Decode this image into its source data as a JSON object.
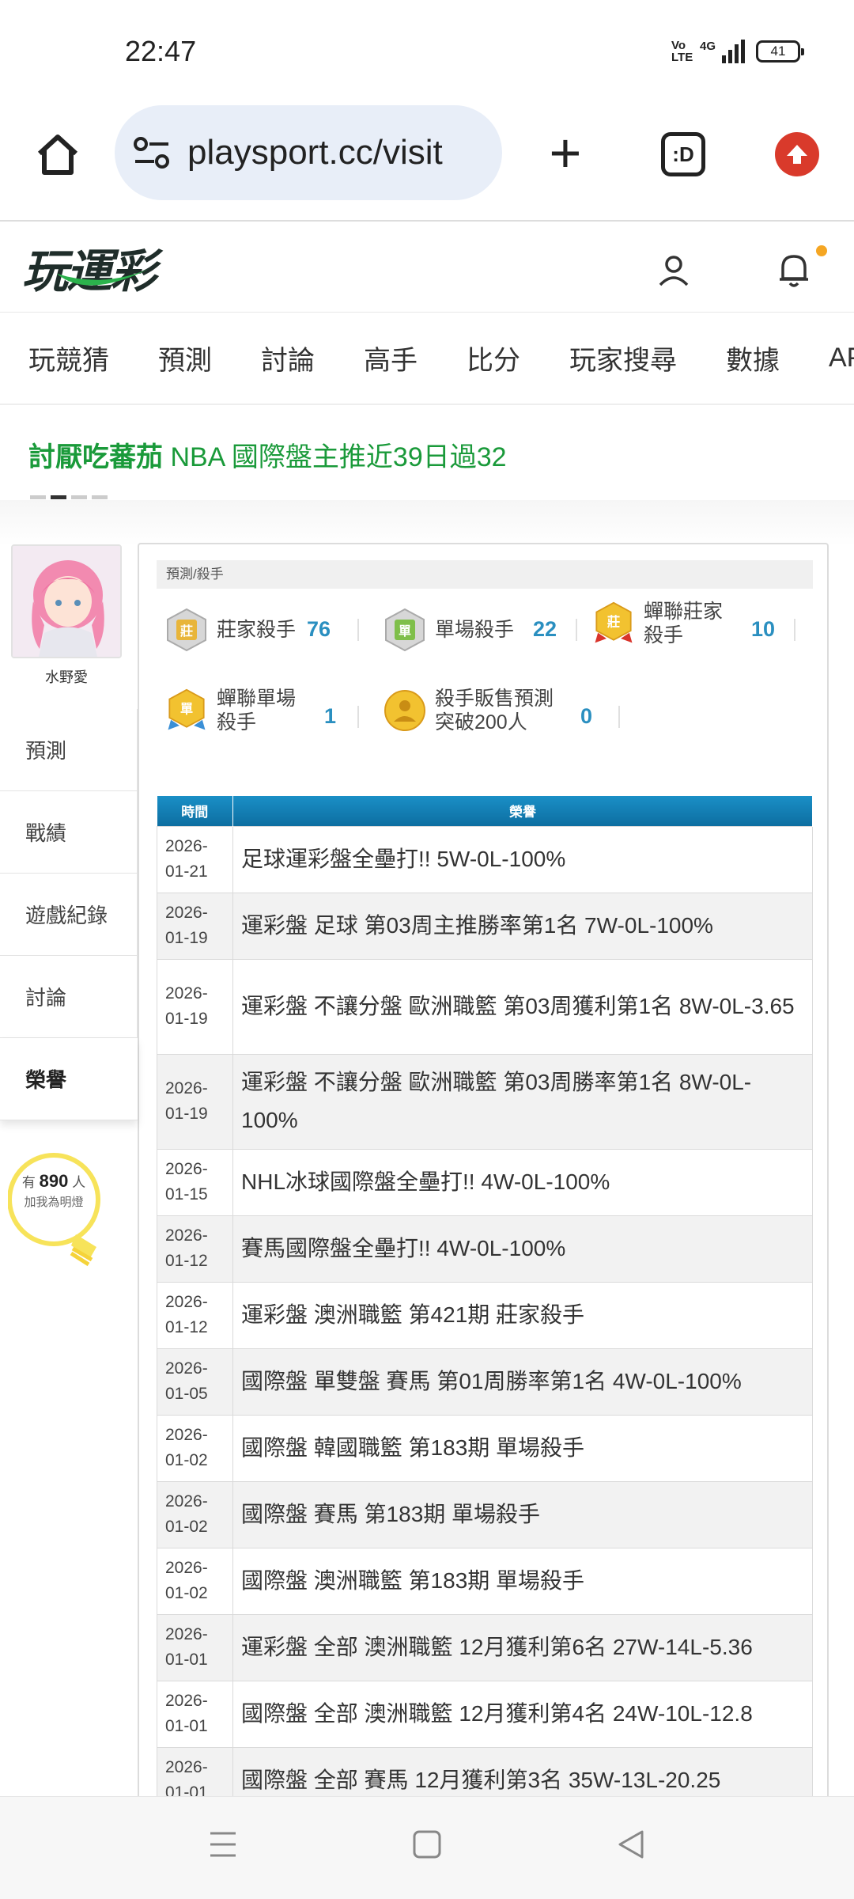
{
  "status": {
    "time": "22:47",
    "network": "4G",
    "volte": "Vo LTE",
    "battery": "41"
  },
  "browser": {
    "url": "playsport.cc/visit",
    "tab_label": ":D"
  },
  "site": {
    "logo": "玩運彩"
  },
  "nav": [
    "玩競猜",
    "預測",
    "討論",
    "高手",
    "比分",
    "玩家搜尋",
    "數據",
    "APP"
  ],
  "ticker": {
    "name": "討厭吃蕃茄",
    "text": "NBA 國際盤主推近39日過32"
  },
  "profile": {
    "username": "水野愛",
    "menu": [
      "預測",
      "戰績",
      "遊戲紀錄",
      "討論",
      "榮譽"
    ],
    "fans_prefix": "有",
    "fans_count": "890",
    "fans_suffix": "人",
    "fans_label": "加我為明燈"
  },
  "breadcrumb": "預測/殺手",
  "medals": [
    {
      "icon": "banker-killer-silver-icon",
      "label_line1": "莊家殺手",
      "label_line2": "",
      "count": "76"
    },
    {
      "icon": "single-killer-silver-icon",
      "label_line1": "單場殺手",
      "label_line2": "",
      "count": "22"
    },
    {
      "icon": "consecutive-banker-gold-icon",
      "label_line1": "蟬聯莊家",
      "label_line2": "殺手",
      "count": "10"
    },
    {
      "icon": "consecutive-single-gold-icon",
      "label_line1": "蟬聯單場",
      "label_line2": "殺手",
      "count": "1"
    },
    {
      "icon": "sales-200-gold-icon",
      "label_line1": "殺手販售預測",
      "label_line2": "突破200人",
      "count": "0"
    }
  ],
  "table": {
    "headers": {
      "time": "時間",
      "honor": "榮譽"
    },
    "rows": [
      {
        "y": "2026-",
        "md": "01-21",
        "text": "足球運彩盤全壘打!! 5W-0L-100%"
      },
      {
        "y": "2026-",
        "md": "01-19",
        "text": "運彩盤 足球 第03周主推勝率第1名 7W-0L-100%"
      },
      {
        "y": "2026-",
        "md": "01-19",
        "text": "運彩盤 不讓分盤 歐洲職籃 第03周獲利第1名 8W-0L-3.65"
      },
      {
        "y": "2026-",
        "md": "01-19",
        "text": "運彩盤 不讓分盤 歐洲職籃 第03周勝率第1名 8W-0L-100%"
      },
      {
        "y": "2026-",
        "md": "01-15",
        "text": "NHL冰球國際盤全壘打!! 4W-0L-100%"
      },
      {
        "y": "2026-",
        "md": "01-12",
        "text": "賽馬國際盤全壘打!! 4W-0L-100%"
      },
      {
        "y": "2026-",
        "md": "01-12",
        "text": "運彩盤 澳洲職籃 第421期 莊家殺手"
      },
      {
        "y": "2026-",
        "md": "01-05",
        "text": "國際盤 單雙盤 賽馬 第01周勝率第1名 4W-0L-100%"
      },
      {
        "y": "2026-",
        "md": "01-02",
        "text": "國際盤 韓國職籃 第183期 單場殺手"
      },
      {
        "y": "2026-",
        "md": "01-02",
        "text": "國際盤 賽馬 第183期 單場殺手"
      },
      {
        "y": "2026-",
        "md": "01-02",
        "text": "國際盤 澳洲職籃 第183期 單場殺手"
      },
      {
        "y": "2026-",
        "md": "01-01",
        "text": "運彩盤 全部 澳洲職籃 12月獲利第6名 27W-14L-5.36"
      },
      {
        "y": "2026-",
        "md": "01-01",
        "text": "國際盤 全部 澳洲職籃 12月獲利第4名 24W-10L-12.8"
      },
      {
        "y": "2026-",
        "md": "01-01",
        "text": "國際盤 全部 賽馬 12月獲利第3名 35W-13L-20.25"
      }
    ]
  },
  "colors": {
    "accent_blue": "#2a8fc0",
    "ticker_green": "#1a9a3a",
    "header_blue": "#1a8fc6",
    "bulb_yellow": "#f7e35a"
  }
}
